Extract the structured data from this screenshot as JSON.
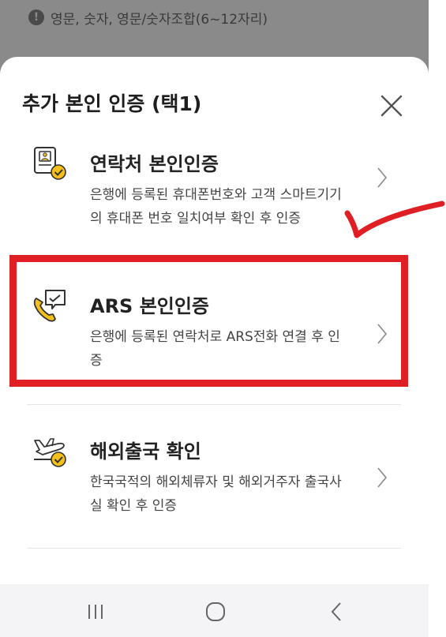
{
  "background": {
    "hint_text": "영문, 숫자, 영문/숫자조합(6~12자리)"
  },
  "sheet": {
    "title": "추가 본인 인증 (택1)"
  },
  "options": [
    {
      "title": "연락처 본인인증",
      "desc_line1": "은행에 등록된 휴대폰번호와 고객 스마트기기",
      "desc_line2": "의 휴대폰 번호 일치여부 확인 후 인증",
      "icon": "contact-card-check-icon"
    },
    {
      "title": "ARS 본인인증",
      "desc_line1": "은행에 등록된 연락처로 ARS전화 연결 후 인",
      "desc_line2": "증",
      "icon": "phone-chat-icon"
    },
    {
      "title": "해외출국 확인",
      "desc_line1": "한국국적의 해외체류자 및 해외거주자 출국사",
      "desc_line2": "실 확인 후 인증",
      "icon": "airplane-check-icon"
    }
  ],
  "colors": {
    "accent_yellow": "#f5c01a",
    "highlight_red": "#e01f25"
  }
}
